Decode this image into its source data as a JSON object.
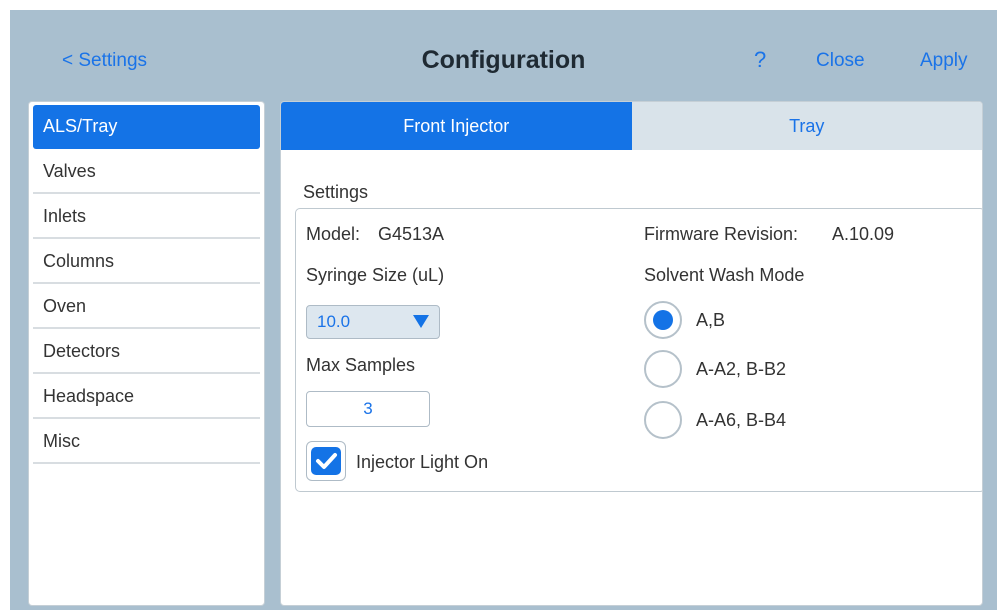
{
  "header": {
    "back_label": "< Settings",
    "title": "Configuration",
    "help_label": "?",
    "close_label": "Close",
    "apply_label": "Apply"
  },
  "sidebar": {
    "items": [
      {
        "label": "ALS/Tray",
        "active": true
      },
      {
        "label": "Valves"
      },
      {
        "label": "Inlets"
      },
      {
        "label": "Columns"
      },
      {
        "label": "Oven"
      },
      {
        "label": "Detectors"
      },
      {
        "label": "Headspace"
      },
      {
        "label": "Misc"
      }
    ]
  },
  "tabs": [
    {
      "label": "Front Injector",
      "active": true
    },
    {
      "label": "Tray"
    }
  ],
  "settings": {
    "section_label": "Settings",
    "model_label": "Model:",
    "model_value": "G4513A",
    "firmware_label": "Firmware Revision:",
    "firmware_value": "A.10.09",
    "syringe_label": "Syringe Size (uL)",
    "syringe_value": "10.0",
    "max_samples_label": "Max Samples",
    "max_samples_value": "3",
    "injector_light_label": "Injector Light On",
    "injector_light_checked": true,
    "wash_mode_label": "Solvent Wash Mode",
    "wash_modes": [
      {
        "label": "A,B",
        "selected": true
      },
      {
        "label": "A-A2, B-B2"
      },
      {
        "label": "A-A6, B-B4"
      }
    ]
  },
  "colors": {
    "accent": "#1473e6",
    "link": "#1a73e8",
    "background": "#a9bfcf",
    "tab_inactive": "#d9e3ea"
  }
}
